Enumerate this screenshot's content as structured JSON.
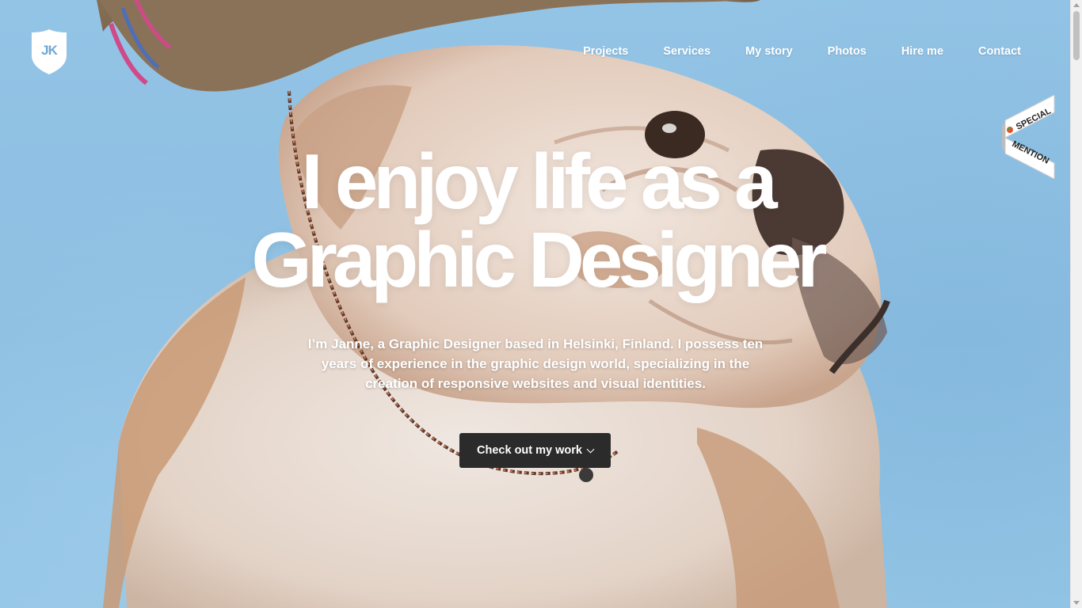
{
  "logo": {
    "initials": "JK"
  },
  "nav": {
    "items": [
      {
        "label": "Projects"
      },
      {
        "label": "Services"
      },
      {
        "label": "My story"
      },
      {
        "label": "Photos"
      },
      {
        "label": "Hire me"
      },
      {
        "label": "Contact"
      }
    ]
  },
  "ribbon": {
    "line1": "SPECIAL",
    "line2": "MENTION"
  },
  "hero": {
    "headline_line1": "I enjoy life as a",
    "headline_line2": "Graphic Designer",
    "intro": "I’m Janne, a Graphic Designer based in Helsinki, Finland. I possess ten years of experience in the graphic design world, specializing in the creation of responsive websites and visual identities.",
    "cta_label": "Check out my work",
    "cta_icon": "chevron-down-icon"
  },
  "colors": {
    "sky": "#8ebfe2",
    "button": "#2b2b2b",
    "logo_accent": "#6fa8d6"
  }
}
